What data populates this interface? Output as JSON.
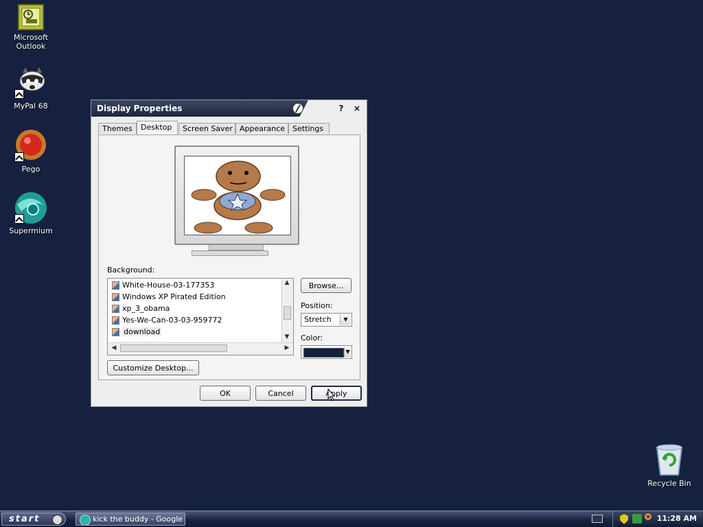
{
  "desktop": {
    "icons": [
      {
        "label": "Microsoft Outlook"
      },
      {
        "label": "MyPal 68"
      },
      {
        "label": "Pego"
      },
      {
        "label": "Supermium"
      },
      {
        "label": "Recycle Bin"
      }
    ]
  },
  "dialog": {
    "title": "Display Properties",
    "help_label": "?",
    "close_label": "×",
    "tabs": [
      {
        "label": "Themes"
      },
      {
        "label": "Desktop"
      },
      {
        "label": "Screen Saver"
      },
      {
        "label": "Appearance"
      },
      {
        "label": "Settings"
      }
    ],
    "active_tab": "Desktop",
    "background_label": "Background:",
    "backgrounds": [
      {
        "label": "White-House-03-177353"
      },
      {
        "label": "Windows XP Pirated Edition"
      },
      {
        "label": "xp_3_obama"
      },
      {
        "label": "Yes-We-Can-03-03-959772"
      },
      {
        "label": "download",
        "selected": true
      }
    ],
    "browse_label": "Browse...",
    "position_label": "Position:",
    "position_value": "Stretch",
    "color_label": "Color:",
    "color_value": "#13203f",
    "customize_label": "Customize Desktop...",
    "ok_label": "OK",
    "cancel_label": "Cancel",
    "apply_label": "Apply"
  },
  "taskbar": {
    "start_label": "start",
    "task_label": "kick the buddy - Google ...",
    "clock": "11:28 AM"
  }
}
